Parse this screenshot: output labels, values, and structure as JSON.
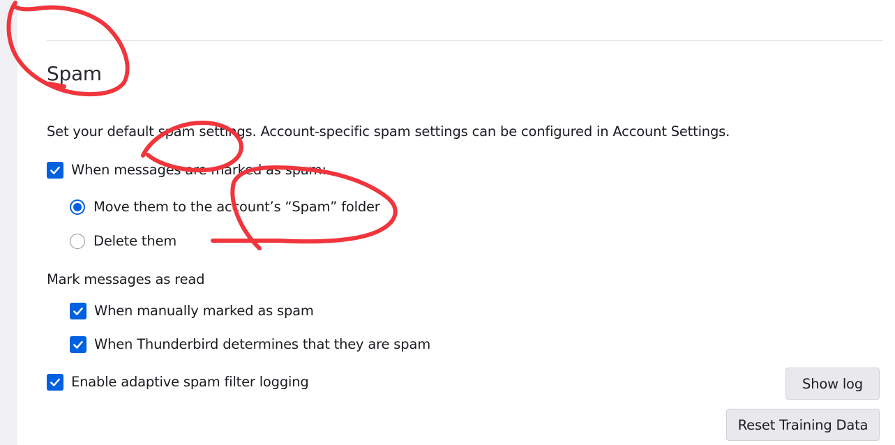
{
  "section": {
    "title": "Spam"
  },
  "description": "Set your default spam settings. Account-specific spam settings can be configured in Account Settings.",
  "when_marked": {
    "label": "When messages are marked as spam:",
    "checked": true
  },
  "spam_action": {
    "options": [
      {
        "label": "Move them to the account’s “Spam” folder",
        "checked": true
      },
      {
        "label": "Delete them",
        "checked": false
      }
    ]
  },
  "mark_read": {
    "heading": "Mark messages as read",
    "options": [
      {
        "label": "When manually marked as spam",
        "checked": true
      },
      {
        "label": "When Thunderbird determines that they are spam",
        "checked": true
      }
    ]
  },
  "logging": {
    "label": "Enable adaptive spam filter logging",
    "checked": true
  },
  "buttons": {
    "show_log": "Show log",
    "reset_training": "Reset Training Data"
  },
  "colors": {
    "accent": "#0061e0",
    "annotation": "#f0353c",
    "button_bg": "#e9e9ed"
  }
}
